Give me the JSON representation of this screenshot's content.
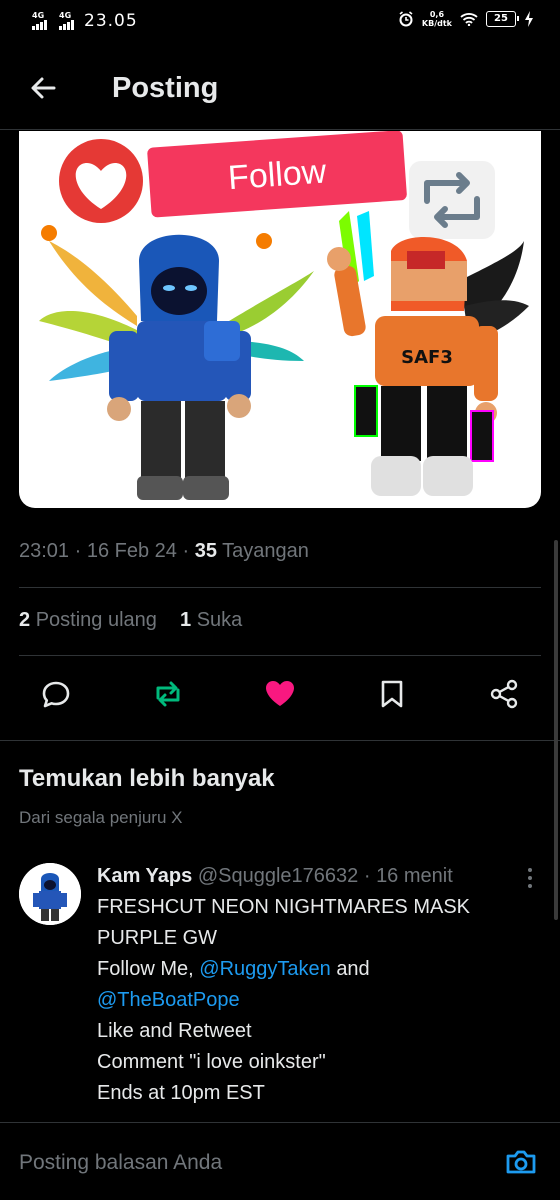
{
  "status_bar": {
    "net1": "4G",
    "net2": "4G",
    "time": "23.05",
    "speed_value": "0,6",
    "speed_unit": "KB/dtk",
    "battery": "25"
  },
  "header": {
    "title": "Posting"
  },
  "post_image": {
    "follow_label": "Follow",
    "shirt_text": "SAF3"
  },
  "post_meta": {
    "time": "23:01",
    "date": "16 Feb 24",
    "views_count": "35",
    "views_label": "Tayangan"
  },
  "stats": {
    "reposts_count": "2",
    "reposts_label": "Posting ulang",
    "likes_count": "1",
    "likes_label": "Suka"
  },
  "colors": {
    "accent": "#1d9bf0",
    "repost_green": "#00ba7c",
    "like_pink": "#f91880",
    "muted": "#71767b",
    "text": "#e7e9ea"
  },
  "discover": {
    "title": "Temukan lebih banyak",
    "subtitle": "Dari segala penjuru X"
  },
  "tweet": {
    "name": "Kam Yaps",
    "handle": "@Squggle176632",
    "sep": "·",
    "time": "16 menit",
    "line1": "FRESHCUT NEON NIGHTMARES MASK",
    "line2": "PURPLE GW",
    "follow_prefix": "Follow Me,",
    "mention1": "@RuggyTaken",
    "and": "and",
    "mention2": "@TheBoatPope",
    "line4": "Like and Retweet",
    "line5": "Comment \"i love oinkster\"",
    "line6": "Ends at 10pm EST"
  },
  "reply": {
    "placeholder": "Posting balasan Anda"
  },
  "icons": [
    "back-arrow-icon",
    "heart-icon",
    "repost-icon",
    "reply-icon",
    "bookmark-icon",
    "share-icon",
    "more-icon",
    "camera-icon",
    "wifi-icon",
    "alarm-icon",
    "charging-icon"
  ]
}
